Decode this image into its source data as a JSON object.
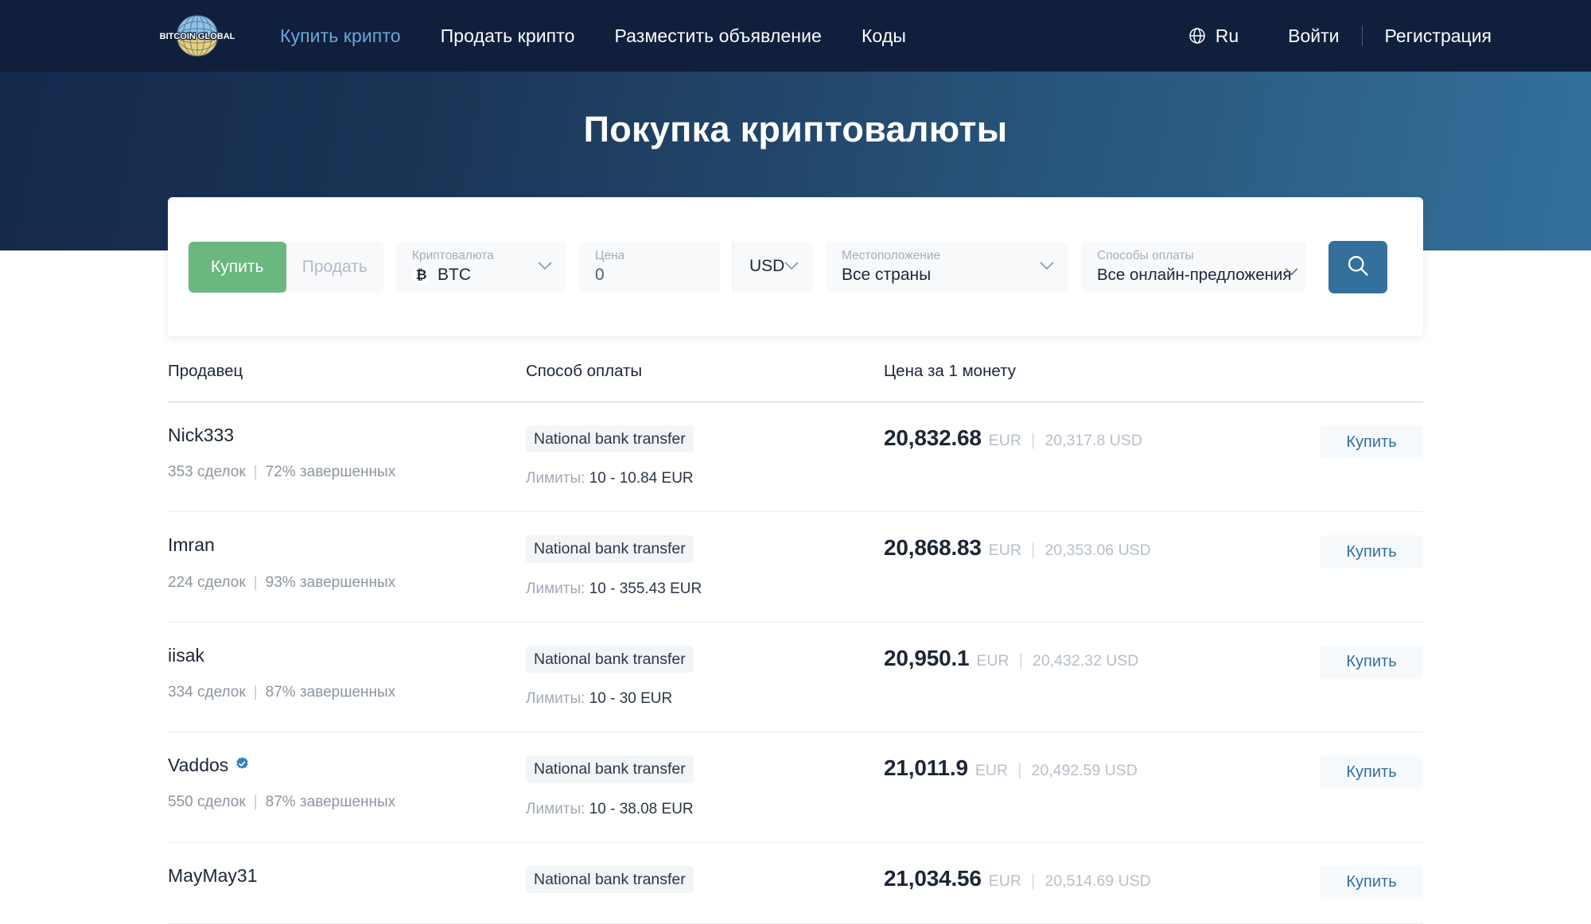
{
  "colors": {
    "nav_bg": "#101f3c",
    "hero_from": "#14294c",
    "hero_to": "#33719c",
    "accent_green": "#6ab77f",
    "accent_blue": "#33719c",
    "link_blue": "#2f6f9c",
    "active_nav": "#6aa8d8"
  },
  "header": {
    "logo_text": "BITCOIN GLOBAL",
    "nav": [
      {
        "label": "Купить крипто",
        "active": true
      },
      {
        "label": "Продать крипто",
        "active": false
      },
      {
        "label": "Разместить объявление",
        "active": false
      },
      {
        "label": "Коды",
        "active": false
      }
    ],
    "language": "Ru",
    "login_label": "Войти",
    "register_label": "Регистрация"
  },
  "hero": {
    "title": "Покупка криптовалюты"
  },
  "search": {
    "buy_label": "Купить",
    "sell_label": "Продать",
    "active_side": "Купить",
    "crypto": {
      "label": "Криптовалюта",
      "value": "BTC",
      "symbol": "₿"
    },
    "price": {
      "label": "Цена",
      "value": "0",
      "placeholder": "0"
    },
    "currency": {
      "value": "USD"
    },
    "location": {
      "label": "Местоположение",
      "value": "Все страны"
    },
    "payment": {
      "label": "Способы оплаты",
      "value": "Все онлайн-предложения"
    },
    "search_icon": "search-icon"
  },
  "table": {
    "columns": {
      "seller": "Продавец",
      "payment": "Способ оплаты",
      "price": "Цена за 1 монету"
    },
    "limits_label": "Лимиты:",
    "buy_button": "Купить",
    "rows": [
      {
        "seller": "Nick333",
        "verified": false,
        "trades": "353 сделок",
        "completion": "72% завершенных",
        "payment_method": "National bank transfer",
        "limits": "10 - 10.84 EUR",
        "price": "20,832.68",
        "currency": "EUR",
        "price_alt": "20,317.8 USD"
      },
      {
        "seller": "Imran",
        "verified": false,
        "trades": "224 сделок",
        "completion": "93% завершенных",
        "payment_method": "National bank transfer",
        "limits": "10 - 355.43 EUR",
        "price": "20,868.83",
        "currency": "EUR",
        "price_alt": "20,353.06 USD"
      },
      {
        "seller": "iisak",
        "verified": false,
        "trades": "334 сделок",
        "completion": "87% завершенных",
        "payment_method": "National bank transfer",
        "limits": "10 - 30 EUR",
        "price": "20,950.1",
        "currency": "EUR",
        "price_alt": "20,432.32 USD"
      },
      {
        "seller": "Vaddos",
        "verified": true,
        "trades": "550 сделок",
        "completion": "87% завершенных",
        "payment_method": "National bank transfer",
        "limits": "10 - 38.08 EUR",
        "price": "21,011.9",
        "currency": "EUR",
        "price_alt": "20,492.59 USD"
      },
      {
        "seller": "MayMay31",
        "verified": false,
        "trades": "",
        "completion": "",
        "payment_method": "National bank transfer",
        "limits": "",
        "price": "21,034.56",
        "currency": "EUR",
        "price_alt": "20,514.69 USD"
      }
    ]
  }
}
